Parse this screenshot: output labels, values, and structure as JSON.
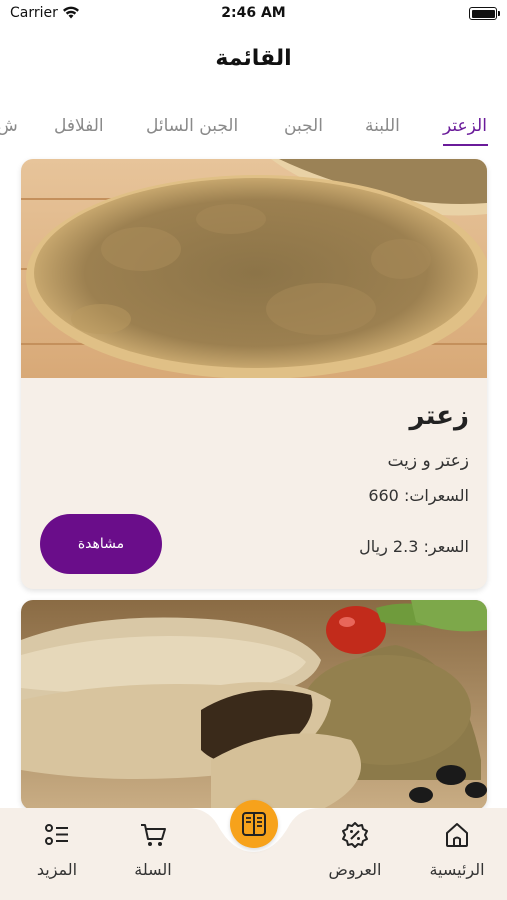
{
  "status_bar": {
    "carrier": "Carrier",
    "time": "2:46 AM"
  },
  "header": {
    "title": "القائمة"
  },
  "tabs": [
    {
      "label": "الزعتر",
      "active": true
    },
    {
      "label": "اللبنة",
      "active": false
    },
    {
      "label": "الجبن",
      "active": false
    },
    {
      "label": "الجبن السائل",
      "active": false
    },
    {
      "label": "الفلافل",
      "active": false
    },
    {
      "label": "ش",
      "active": false
    }
  ],
  "items": [
    {
      "name": "زعتر",
      "description": "زعتر و زيت",
      "calories_label": "السعرات:",
      "calories": "660",
      "price_label": "السعر:",
      "price": "2.3 ريال",
      "view_label": "مشاهدة",
      "image": "zaatar-manakish"
    },
    {
      "image": "zaatar-pastries"
    }
  ],
  "bottom_nav": [
    {
      "label": "المزيد",
      "icon": "list-icon"
    },
    {
      "label": "السلة",
      "icon": "cart-icon"
    },
    {
      "label": "",
      "icon": "menu-book-icon"
    },
    {
      "label": "العروض",
      "icon": "discount-badge-icon"
    },
    {
      "label": "الرئيسية",
      "icon": "home-icon"
    }
  ],
  "colors": {
    "accent": "#6a1b9a",
    "button": "#6a0d8a",
    "orange": "#f7a21b",
    "card_bg": "#f6efe8"
  }
}
